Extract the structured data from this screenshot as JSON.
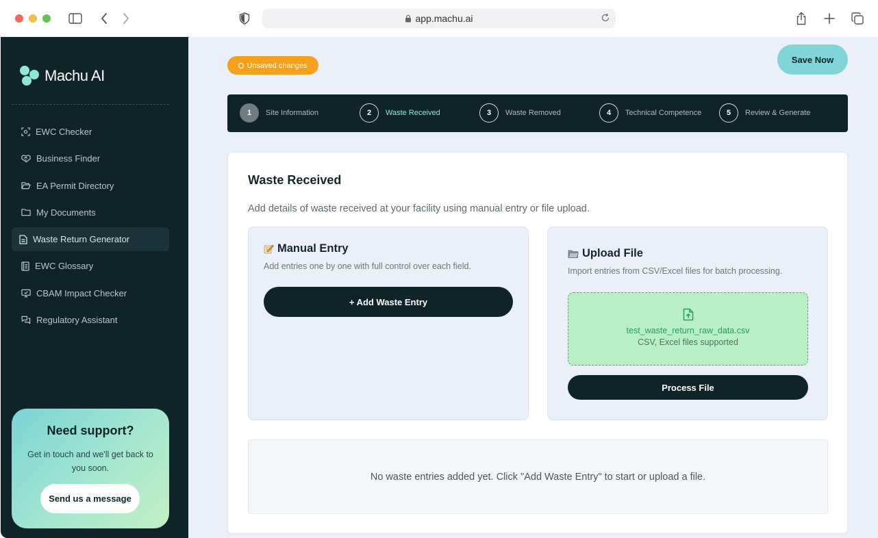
{
  "browser": {
    "url": "app.machu.ai",
    "traffic_colors": [
      "#ee6a5f",
      "#f5bd4f",
      "#61c454"
    ]
  },
  "sidebar": {
    "logo_text": "Machu AI",
    "items": [
      {
        "label": "EWC Checker",
        "icon": "scan-icon",
        "active": false
      },
      {
        "label": "Business Finder",
        "icon": "handshake-icon",
        "active": false
      },
      {
        "label": "EA Permit Directory",
        "icon": "folder-open-icon",
        "active": false
      },
      {
        "label": "My Documents",
        "icon": "folder-icon",
        "active": false
      },
      {
        "label": "Waste Return Generator",
        "icon": "document-icon",
        "active": true
      },
      {
        "label": "EWC Glossary",
        "icon": "book-icon",
        "active": false
      },
      {
        "label": "CBAM Impact Checker",
        "icon": "monitor-check-icon",
        "active": false
      },
      {
        "label": "Regulatory Assistant",
        "icon": "chat-icon",
        "active": false
      }
    ],
    "support": {
      "title": "Need support?",
      "text": "Get in touch and we'll get back to you soon.",
      "button": "Send us a message"
    }
  },
  "header": {
    "unsaved_badge": "Unsaved changes",
    "save_button": "Save Now"
  },
  "stepper": {
    "steps": [
      {
        "number": "1",
        "label": "Site Information",
        "state": "done"
      },
      {
        "number": "2",
        "label": "Waste Received",
        "state": "current"
      },
      {
        "number": "3",
        "label": "Waste Removed",
        "state": "pending"
      },
      {
        "number": "4",
        "label": "Technical Competence",
        "state": "pending"
      },
      {
        "number": "5",
        "label": "Review & Generate",
        "state": "pending"
      }
    ]
  },
  "content": {
    "title": "Waste Received",
    "intro": "Add details of waste received at your facility using manual entry or file upload.",
    "manual": {
      "title": "Manual Entry",
      "icon": "memo-icon",
      "subtitle": "Add entries one by one with full control over each field.",
      "button": "+ Add Waste Entry"
    },
    "upload": {
      "title": "Upload File",
      "icon": "folder-icon",
      "subtitle": "Import entries from CSV/Excel files for batch processing.",
      "file_name": "test_waste_return_raw_data.csv",
      "hint": "CSV, Excel files supported",
      "button": "Process File"
    },
    "empty_message": "No waste entries added yet. Click \"Add Waste Entry\" to start or upload a file."
  }
}
